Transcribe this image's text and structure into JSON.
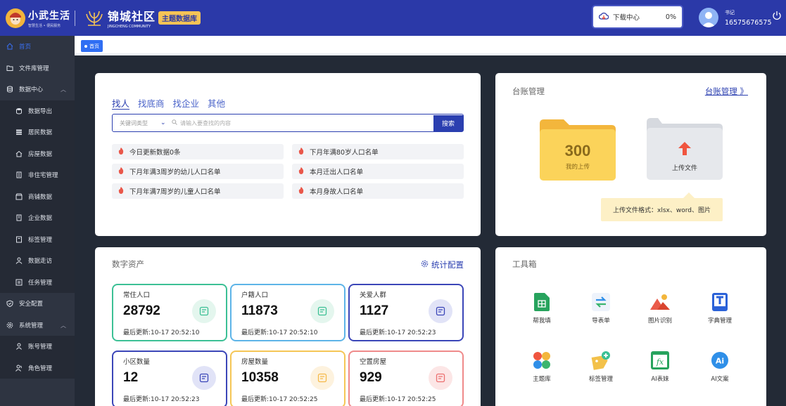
{
  "header": {
    "brand1_title": "小武生活",
    "brand1_subtitle": "智慧生活 • 便民服务",
    "brand2_title": "锦城社区",
    "brand2_subtitle": "JINGCHENG COMMUNITY",
    "topic_badge": "主题数据库",
    "download_label": "下载中心",
    "download_percent": "0%",
    "user_role": "书记",
    "user_phone": "16575676575"
  },
  "sidebar": {
    "items": [
      {
        "label": "首页",
        "icon": "home-icon"
      },
      {
        "label": "文件库管理",
        "icon": "folder-icon"
      },
      {
        "label": "数据中心",
        "icon": "database-icon"
      },
      {
        "label": "数据导出",
        "icon": "export-icon"
      },
      {
        "label": "居民数据",
        "icon": "resident-icon"
      },
      {
        "label": "房屋数据",
        "icon": "house-icon"
      },
      {
        "label": "非住宅管理",
        "icon": "building-icon"
      },
      {
        "label": "商铺数据",
        "icon": "shop-icon"
      },
      {
        "label": "企业数据",
        "icon": "enterprise-icon"
      },
      {
        "label": "标签管理",
        "icon": "tag-icon"
      },
      {
        "label": "数据走访",
        "icon": "visit-icon"
      },
      {
        "label": "任务管理",
        "icon": "task-icon"
      },
      {
        "label": "安全配置",
        "icon": "shield-icon"
      },
      {
        "label": "系统管理",
        "icon": "gear-icon"
      },
      {
        "label": "账号管理",
        "icon": "user-icon"
      },
      {
        "label": "角色管理",
        "icon": "role-icon"
      }
    ]
  },
  "tabs": {
    "home": "首页"
  },
  "search": {
    "tabs": [
      "找人",
      "找底商",
      "找企业",
      "其他"
    ],
    "keyword_type_placeholder": "关键词类型",
    "input_placeholder": "请输入要查找的内容",
    "button": "搜索",
    "quick_links": [
      "今日更新数据0条",
      "下月年满80岁人口名单",
      "下月年满3周岁的幼儿人口名单",
      "本月迁出人口名单",
      "下月年满7周岁的儿童人口名单",
      "本月身故人口名单"
    ]
  },
  "ledger": {
    "title": "台账管理",
    "link": "台账管理 》",
    "my_upload_count": "300",
    "my_upload_label": "我的上传",
    "upload_label": "上传文件",
    "upload_tip": "上传文件格式：xlsx、word、图片"
  },
  "assets": {
    "title": "数字资产",
    "stat_config": "统计配置",
    "items": [
      {
        "label": "常住人口",
        "value": "28792",
        "updated": "最后更新:10-17 20:52:10",
        "color": "#3cc095",
        "bg": "#e4f6ee"
      },
      {
        "label": "户籍人口",
        "value": "11873",
        "updated": "最后更新:10-17 20:52:10",
        "color": "#5db4e8",
        "bg": "#e4f6ee"
      },
      {
        "label": "关爱人群",
        "value": "1127",
        "updated": "最后更新:10-17 20:52:23",
        "color": "#3b46b8",
        "bg": "#e1e3f7"
      },
      {
        "label": "小区数量",
        "value": "12",
        "updated": "最后更新:10-17 20:52:23",
        "color": "#3b46b8",
        "bg": "#e1e3f7"
      },
      {
        "label": "房屋数量",
        "value": "10358",
        "updated": "最后更新:10-17 20:52:25",
        "color": "#f5c656",
        "bg": "#fdf2de"
      },
      {
        "label": "空置房屋",
        "value": "929",
        "updated": "最后更新:10-17 20:52:25",
        "color": "#ef8a8a",
        "bg": "#fce6e6"
      }
    ]
  },
  "tools": {
    "title": "工具箱",
    "items": [
      "帮我填",
      "导表单",
      "图片识别",
      "字典管理",
      "主题库",
      "标签管理",
      "AI表妹",
      "AI文案"
    ]
  }
}
